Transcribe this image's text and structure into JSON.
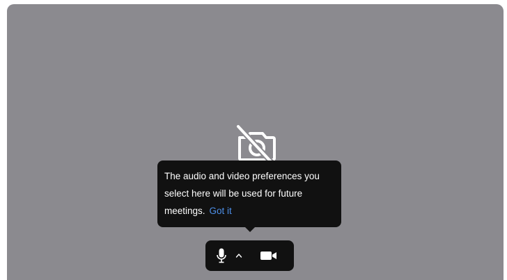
{
  "tooltip": {
    "line1": "The audio and video preferences you",
    "line2": "select here will be used for future",
    "line3": "meetings.",
    "link_label": "Got it"
  },
  "toolbar": {
    "mic_icon": "microphone-icon",
    "options_icon": "caret-up-icon",
    "video_icon": "video-camera-icon"
  },
  "preview": {
    "state_icon": "camera-off-icon"
  },
  "colors": {
    "preview_bg": "#8b8a8f",
    "tooltip_bg": "#111111",
    "link": "#4d8fe8",
    "icon": "#ffffff"
  }
}
